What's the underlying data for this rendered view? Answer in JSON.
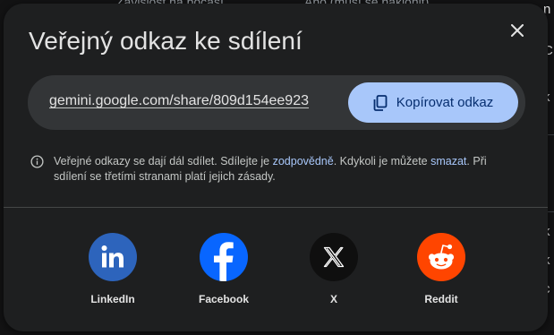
{
  "background": {
    "top_texts": [
      "Závislost na počasí",
      "Ano (musí se naklonit)"
    ],
    "right_chars": [
      "n",
      "C",
      "k",
      "k",
      "k",
      "c"
    ]
  },
  "dialog": {
    "title": "Veřejný odkaz ke sdílení",
    "close_icon": "close-icon",
    "link_url": "gemini.google.com/share/809d154ee923",
    "copy_button_label": "Kopírovat odkaz",
    "info": {
      "part1": "Veřejné odkazy se dají dál sdílet. Sdílejte je ",
      "link1": "zodpovědně",
      "part2": ". Kdykoli je můžete ",
      "link2": "smazat",
      "part3": ". Při sdílení se třetími stranami platí jejich zásady."
    },
    "share_targets": [
      {
        "name": "LinkedIn",
        "icon": "linkedin-icon",
        "color": "#2d64bc"
      },
      {
        "name": "Facebook",
        "icon": "facebook-icon",
        "color": "#0866ff"
      },
      {
        "name": "X",
        "icon": "x-icon",
        "color": "#0f0f0f"
      },
      {
        "name": "Reddit",
        "icon": "reddit-icon",
        "color": "#ff4500"
      }
    ]
  },
  "colors": {
    "dialog_bg": "#1e1f20",
    "accent": "#a8c7fa",
    "link_field_bg": "#333537"
  }
}
